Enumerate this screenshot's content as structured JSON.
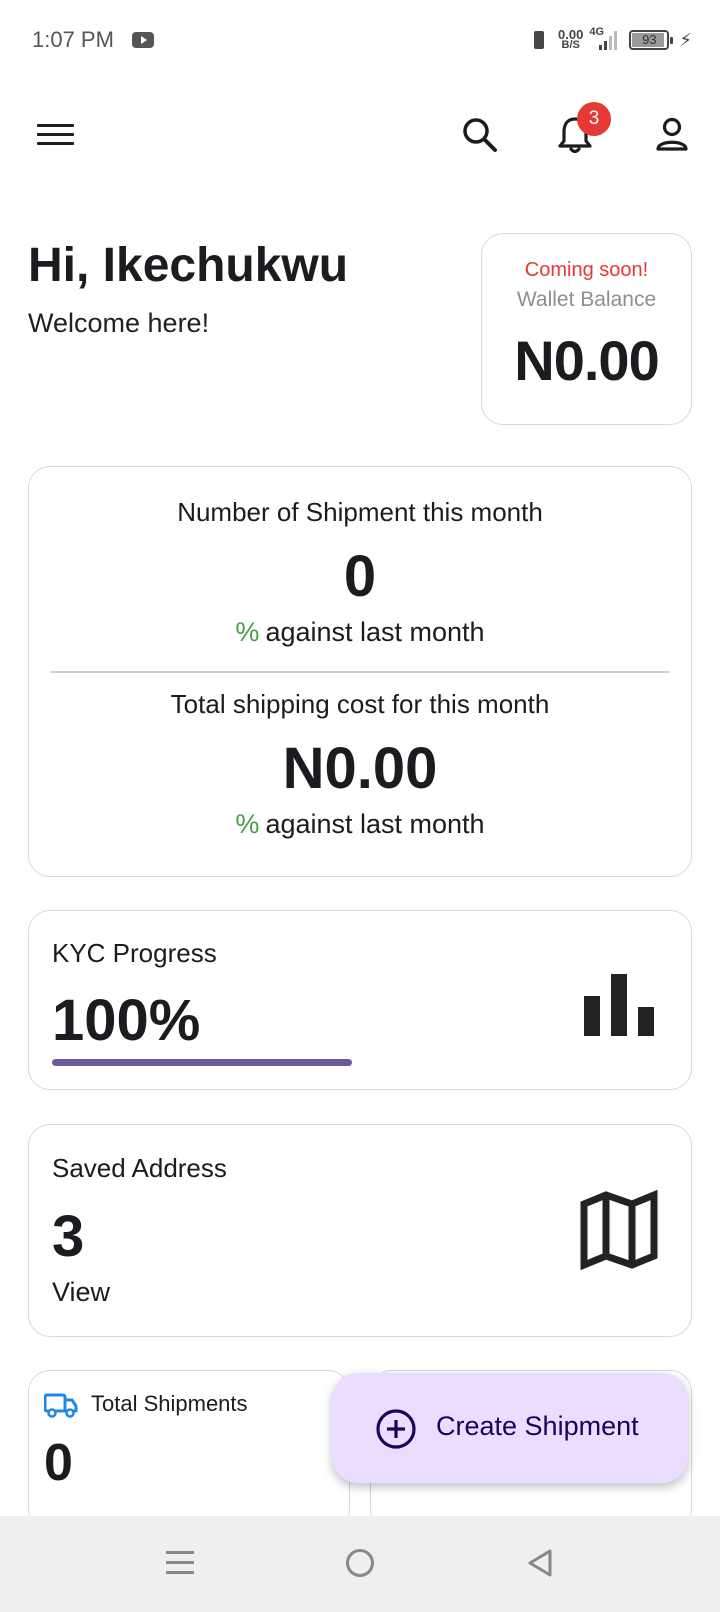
{
  "status_bar": {
    "time": "1:07 PM",
    "net_speed_value": "0.00",
    "net_speed_unit": "B/S",
    "network_type": "4G",
    "battery_level": "93"
  },
  "app_bar": {
    "notification_count": "3"
  },
  "greeting": {
    "title": "Hi, Ikechukwu",
    "subtitle": "Welcome here!"
  },
  "wallet": {
    "coming_soon": "Coming soon!",
    "label": "Wallet Balance",
    "amount": "N0.00"
  },
  "stats": {
    "shipments_title": "Number of Shipment this month",
    "shipments_value": "0",
    "shipments_pct": "%",
    "shipments_compare": "against last month",
    "cost_title": "Total shipping cost for this month",
    "cost_value": "N0.00",
    "cost_pct": "%",
    "cost_compare": "against last month"
  },
  "kyc": {
    "label": "KYC Progress",
    "value": "100%",
    "progress": 1.0
  },
  "address": {
    "label": "Saved Address",
    "count": "3",
    "link": "View"
  },
  "total_shipments": {
    "label": "Total Shipments",
    "value": "0"
  },
  "fab": {
    "label": "Create Shipment"
  },
  "colors": {
    "accent": "#eaddff",
    "badge": "#e53935",
    "positive": "#43a047",
    "progress": "#6d5a98",
    "truck": "#1e88e5"
  }
}
